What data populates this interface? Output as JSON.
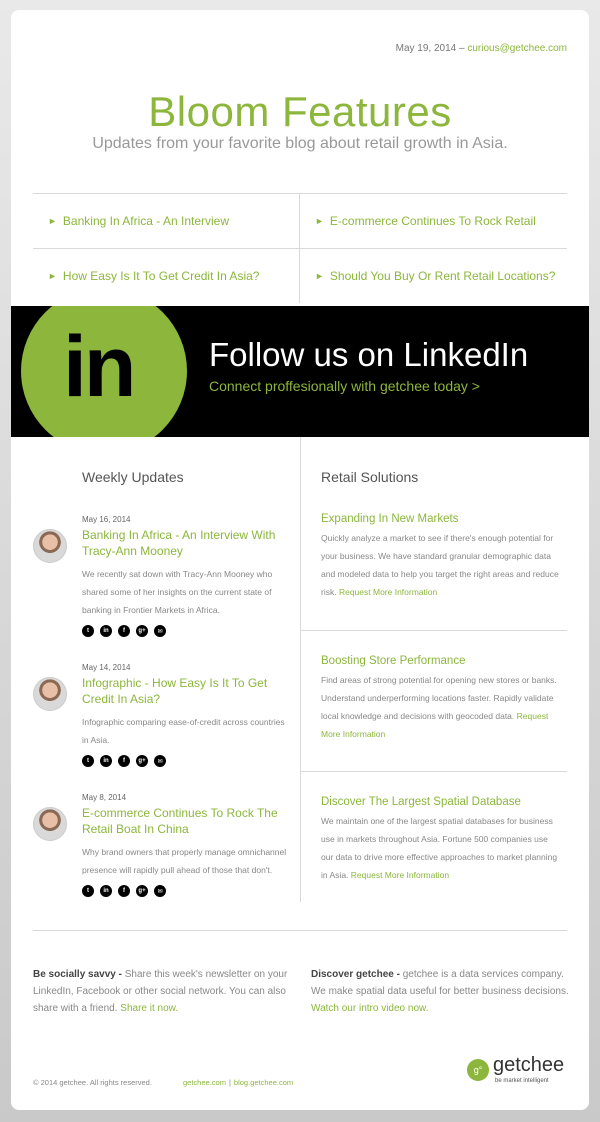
{
  "header": {
    "date": "May 19, 2014",
    "separator": "–",
    "email": "curious@getchee.com",
    "title": "Bloom Features",
    "subtitle": "Updates from your favorite blog about retail growth in Asia."
  },
  "quick_links": [
    {
      "label": "Banking In Africa - An Interview"
    },
    {
      "label": "E-commerce Continues To Rock Retail"
    },
    {
      "label": "How Easy Is It To Get Credit In Asia?"
    },
    {
      "label": "Should You Buy Or Rent Retail Locations?"
    }
  ],
  "banner": {
    "logo_text": "in",
    "title": "Follow us on LinkedIn",
    "subtitle": "Connect proffesionally with getchee today >"
  },
  "weekly": {
    "title": "Weekly Updates",
    "posts": [
      {
        "date": "May 16, 2014",
        "title": "Banking In Africa - An Interview With Tracy-Ann Mooney",
        "desc": "We recently sat down with Tracy-Ann Mooney who shared some of her insights on the current state of banking in Frontier Markets in Africa."
      },
      {
        "date": "May 14, 2014",
        "title": "Infographic - How Easy Is It To Get Credit In Asia?",
        "desc": "Infographic comparing ease-of-credit across countries in Asia."
      },
      {
        "date": "May 8, 2014",
        "title": "E-commerce Continues To Rock The Retail Boat In China",
        "desc": "Why brand owners that properly manage omnichannel presence will rapidly pull ahead of those that don't."
      }
    ],
    "share_icons": [
      "t",
      "in",
      "f",
      "g+",
      "✉"
    ]
  },
  "solutions": {
    "title": "Retail Solutions",
    "items": [
      {
        "title": "Expanding In New Markets",
        "desc": "Quickly analyze a market to see if there's enough potential for your business. We have standard granular demographic data and modeled data to help you target the right areas and reduce risk.",
        "link": "Request More Information"
      },
      {
        "title": "Boosting Store Performance",
        "desc": "Find areas of strong potential for opening new stores or banks. Understand underperforming locations faster. Rapidly validate local knowledge and decisions with geocoded data.",
        "link": "Request More Information"
      },
      {
        "title": "Discover The Largest Spatial Database",
        "desc": "We maintain one of the largest spatial databases for business use in markets throughout Asia. Fortune 500 companies use our data to drive more effective approaches to market planning in Asia.",
        "link": "Request More Information"
      }
    ]
  },
  "footer": {
    "social_bold": "Be socially savvy -",
    "social_text": "Share this week's newsletter on your LinkedIn, Facebook or other social network. You can also share with a friend.",
    "social_link": "Share it now.",
    "discover_bold": "Discover getchee -",
    "discover_text": "getchee is a data services company. We make spatial data useful for better business decisions.",
    "discover_link": "Watch our intro video now.",
    "copyright": "© 2014 getchee. All rights reserved.",
    "link1": "getchee.com",
    "link_sep": "|",
    "link2": "blog.getchee.com",
    "logo_mark": "g°",
    "logo_name": "getchee",
    "logo_tag": "be market intelligent"
  },
  "colors": {
    "accent": "#8cb63c",
    "banner_bg": "#000000"
  }
}
